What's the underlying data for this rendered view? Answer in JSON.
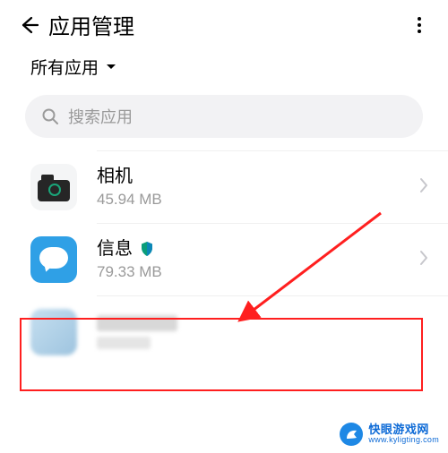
{
  "header": {
    "title": "应用管理"
  },
  "filter": {
    "label": "所有应用"
  },
  "search": {
    "placeholder": "搜索应用"
  },
  "apps": {
    "camera": {
      "name": "相机",
      "size": "45.94 MB"
    },
    "messages": {
      "name": "信息",
      "size": "79.33 MB"
    }
  },
  "watermark": {
    "line1": "快眼游戏网",
    "line2": "www.kyligting.com"
  }
}
